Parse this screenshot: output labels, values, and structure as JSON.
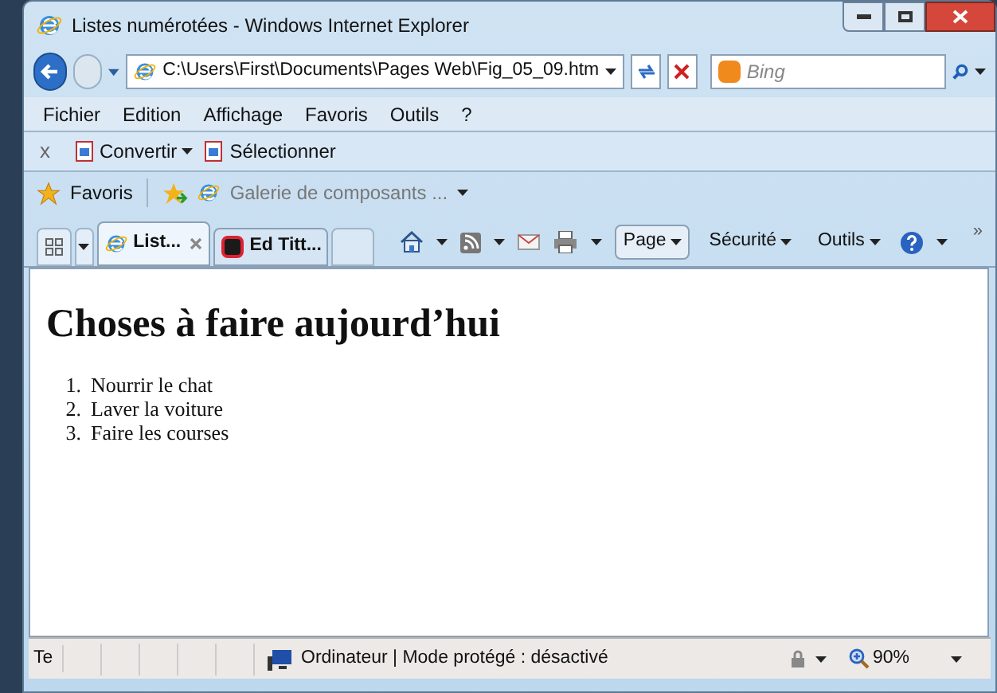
{
  "window": {
    "title": "Listes numérotées - Windows Internet Explorer"
  },
  "address_bar": {
    "value": "C:\\Users\\First\\Documents\\Pages Web\\Fig_05_09.htm"
  },
  "search": {
    "placeholder": "Bing"
  },
  "menu": [
    "Fichier",
    "Edition",
    "Affichage",
    "Favoris",
    "Outils",
    "?"
  ],
  "addon_toolbar": {
    "close": "x",
    "items": [
      "Convertir",
      "Sélectionner"
    ]
  },
  "favorites_bar": {
    "label": "Favoris",
    "gallery": "Galerie de composants ..."
  },
  "tabs": [
    {
      "label": "List...",
      "selected": true
    },
    {
      "label": "Ed Titt...",
      "selected": false
    }
  ],
  "command_bar": {
    "items": [
      "Page",
      "Sécurité",
      "Outils"
    ],
    "more": "»"
  },
  "page": {
    "heading": "Choses à faire aujourd’hui",
    "list": [
      {
        "number": "1.",
        "text": "Nourrir le chat"
      },
      {
        "number": "2.",
        "text": "Laver la voiture"
      },
      {
        "number": "3.",
        "text": "Faire les courses"
      }
    ]
  },
  "status_bar": {
    "text": "Te",
    "zone": "Ordinateur | Mode protégé : désactivé",
    "zoom": "90%"
  }
}
